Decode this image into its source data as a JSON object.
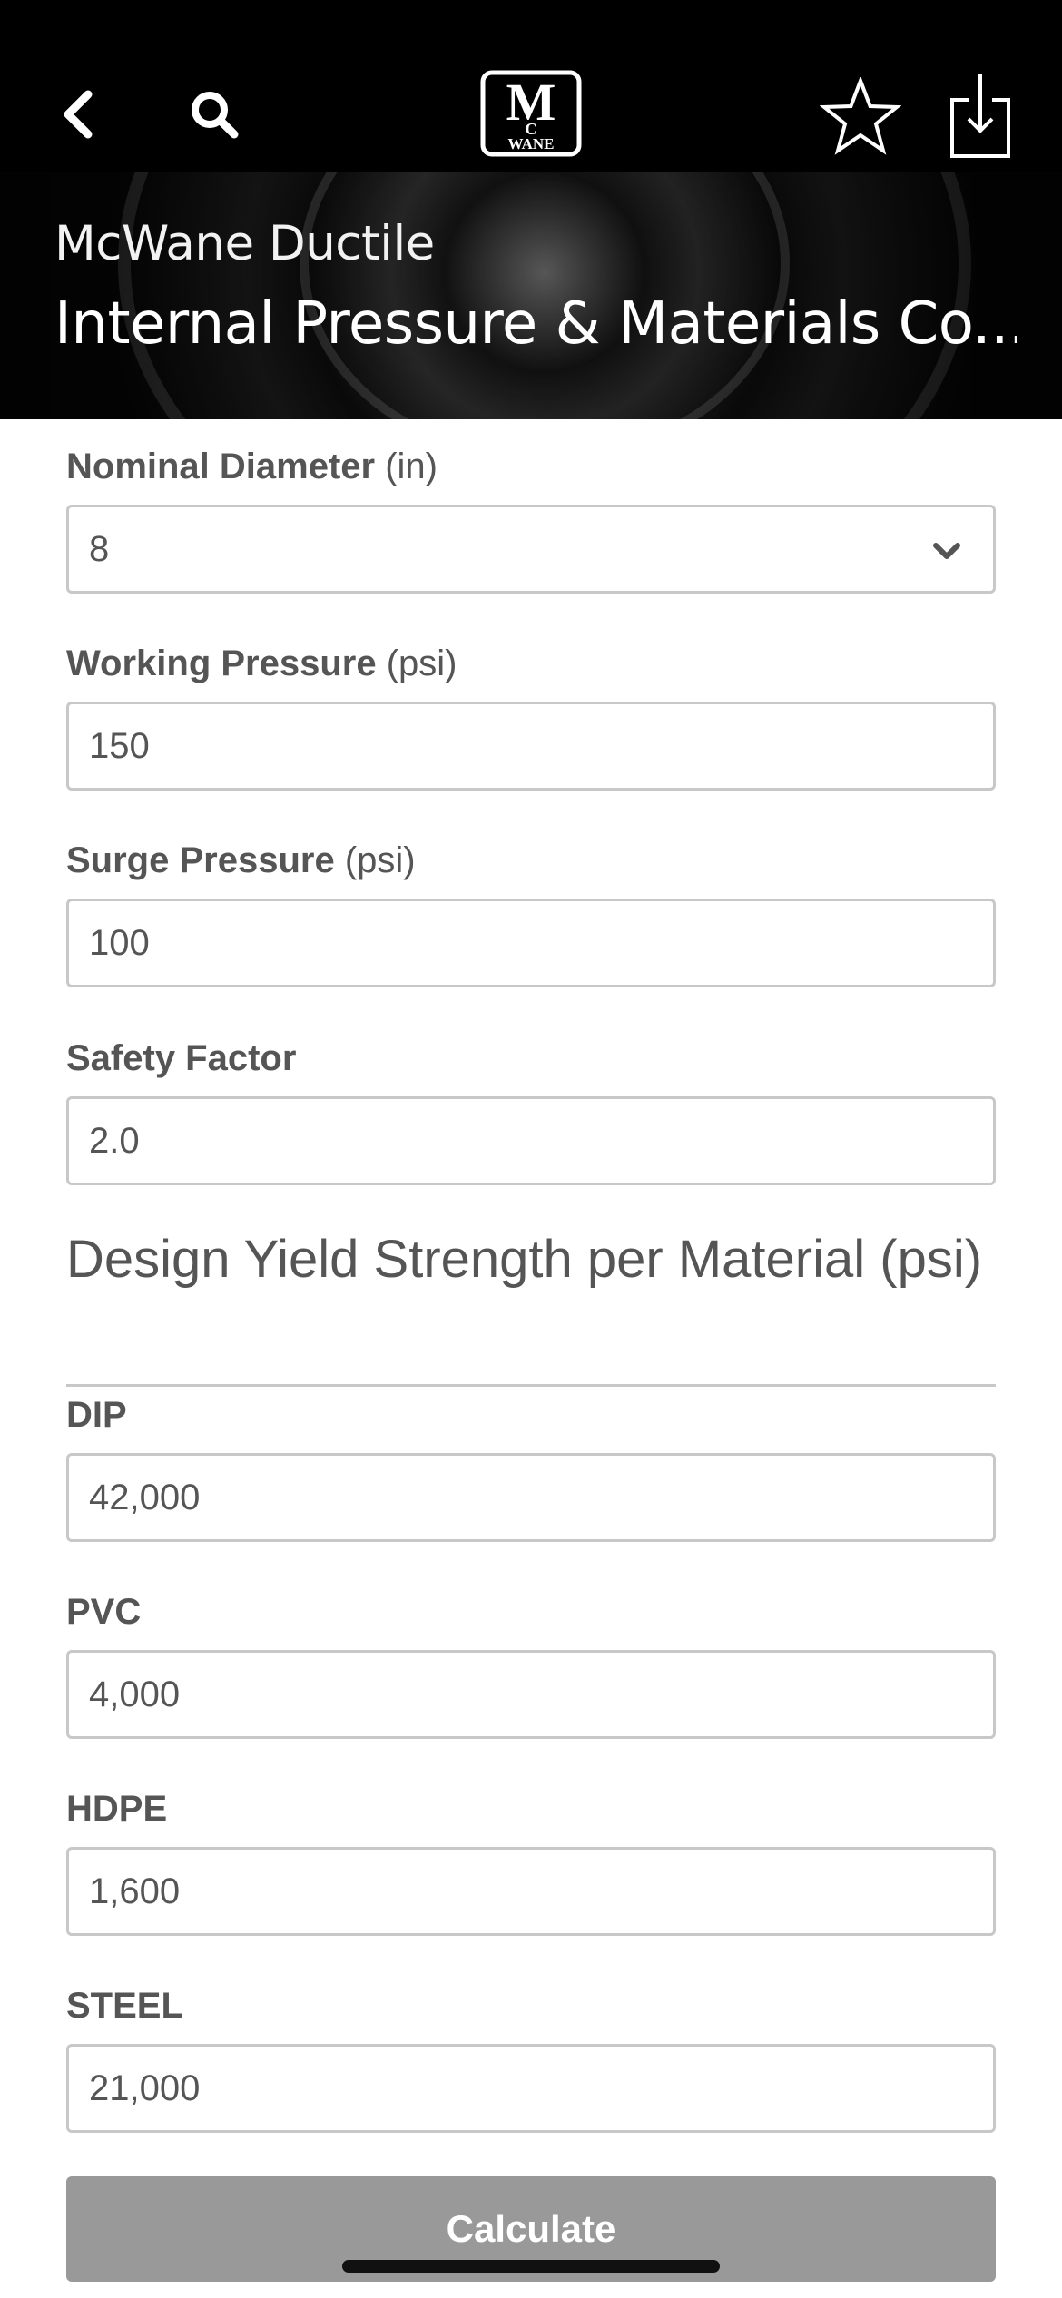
{
  "nav": {
    "back_icon": "chevron-left-icon",
    "search_icon": "search-icon",
    "logo_text_top": "M",
    "logo_text_mid": "C",
    "logo_text_bottom": "WANE",
    "favorite_icon": "star-outline-icon",
    "download_icon": "download-icon"
  },
  "header": {
    "subtitle": "McWane Ductile",
    "title": "Internal Pressure & Materials Co..."
  },
  "form": {
    "nominal_diameter": {
      "label_bold": "Nominal Diameter",
      "label_unit": " (in)",
      "value": "8"
    },
    "working_pressure": {
      "label_bold": "Working Pressure",
      "label_unit": " (psi)",
      "value": "150"
    },
    "surge_pressure": {
      "label_bold": "Surge Pressure",
      "label_unit": " (psi)",
      "value": "100"
    },
    "safety_factor": {
      "label_bold": "Safety Factor",
      "value": "2.0"
    },
    "section_title": "Design Yield Strength per Material (psi)",
    "materials": [
      {
        "label": "DIP",
        "value": "42,000"
      },
      {
        "label": "PVC",
        "value": "4,000"
      },
      {
        "label": "HDPE",
        "value": "1,600"
      },
      {
        "label": "STEEL",
        "value": "21,000"
      }
    ],
    "calculate_label": "Calculate"
  },
  "colors": {
    "topbar": "#000000",
    "text": "#555555",
    "border": "#c8c8c8",
    "button": "#999999"
  }
}
